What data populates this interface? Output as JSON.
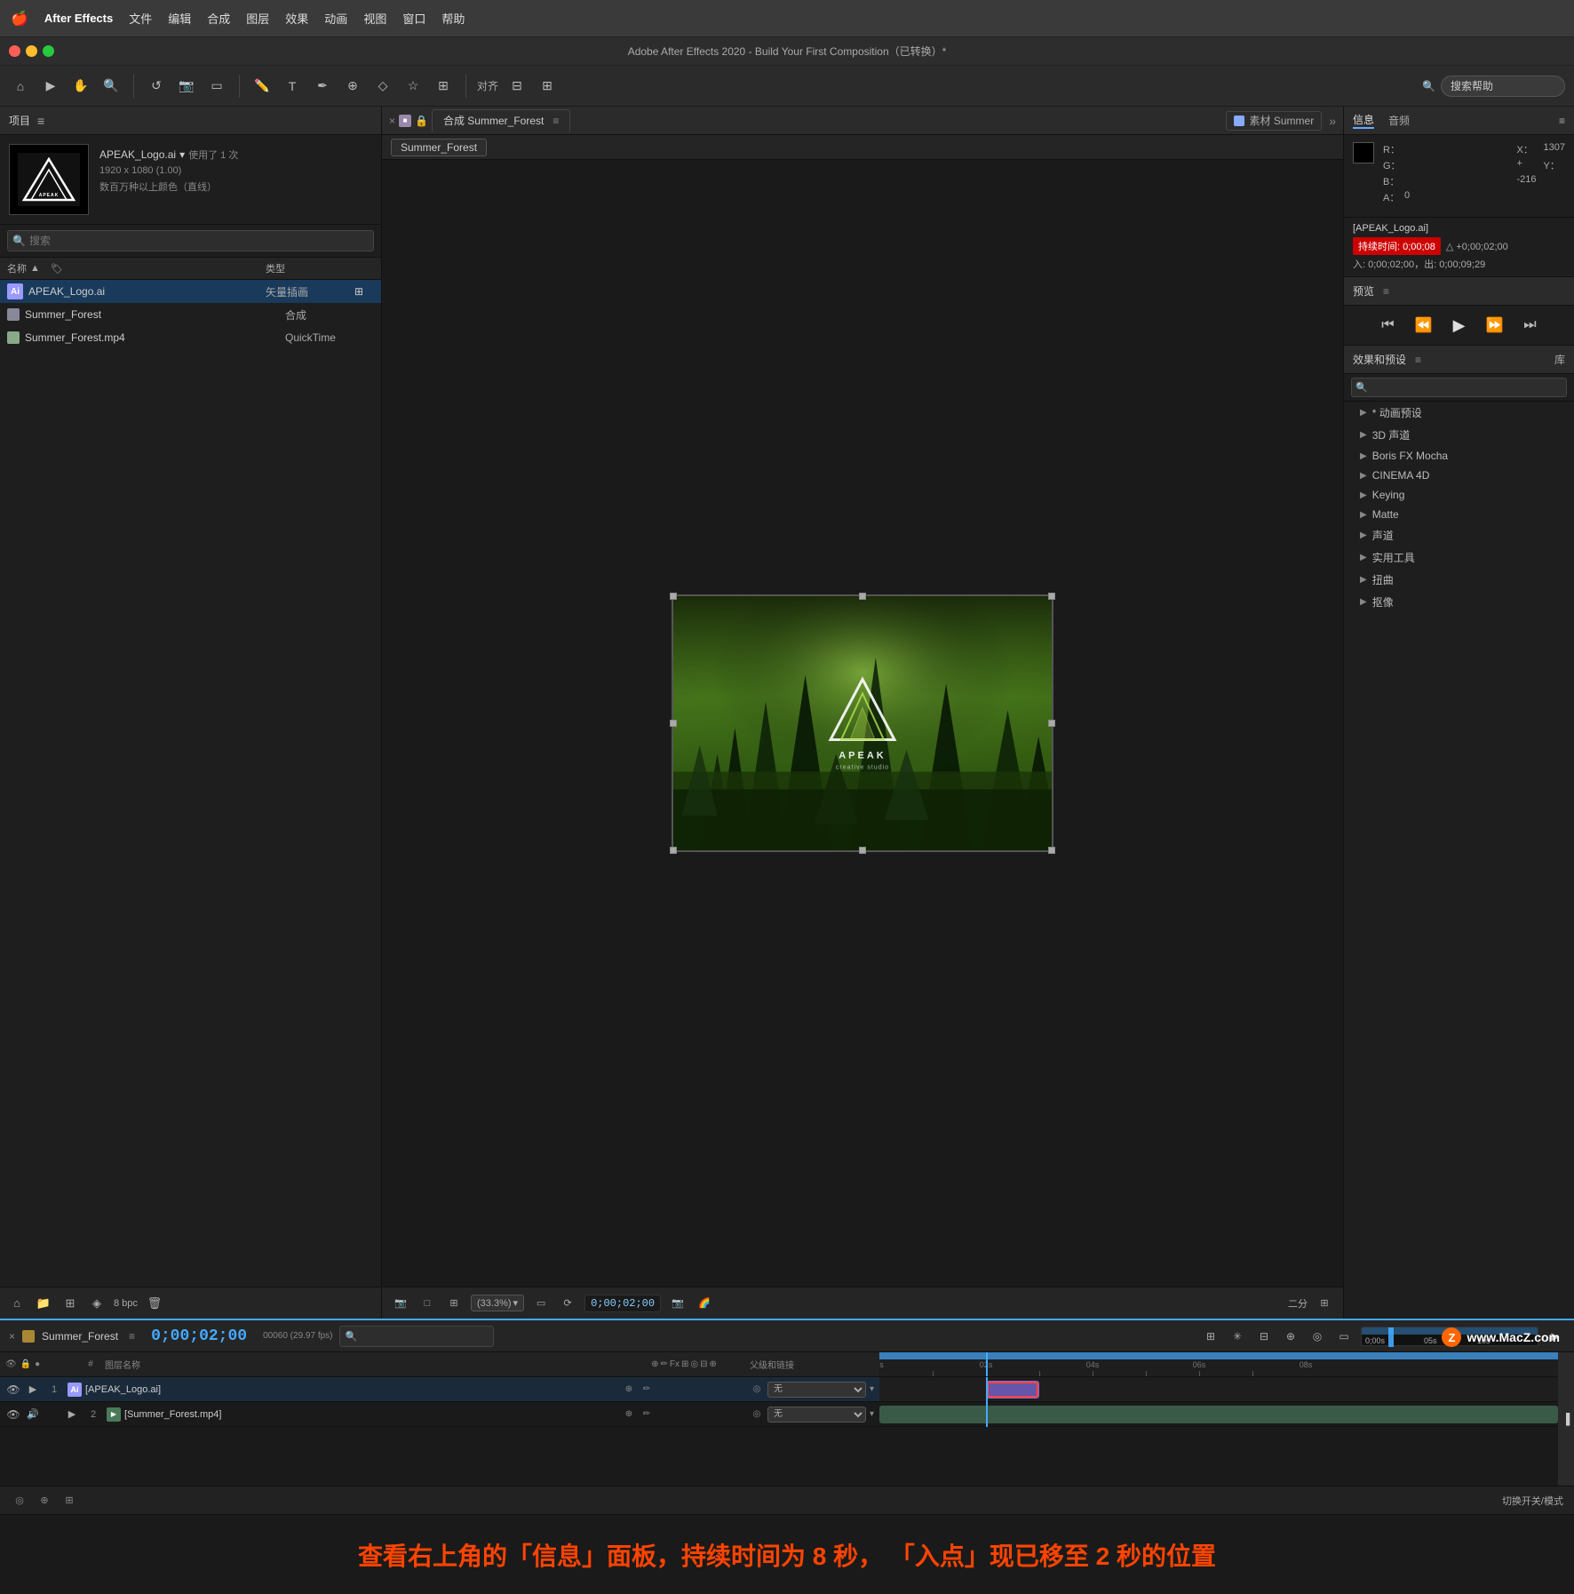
{
  "app": {
    "name": "After Effects",
    "title": "Adobe After Effects 2020 - Build Your First Composition（已转换）*"
  },
  "menubar": {
    "apple": "🍎",
    "items": [
      "After Effects",
      "文件",
      "编辑",
      "合成",
      "图层",
      "效果",
      "动画",
      "视图",
      "窗口",
      "帮助"
    ]
  },
  "toolbar": {
    "search_placeholder": "搜索帮助",
    "align_label": "对齐"
  },
  "left_panel": {
    "title": "项目",
    "menu_icon": "≡",
    "asset": {
      "name": "APEAK_Logo.ai",
      "dropdown": "▾",
      "usage": "使用了 1 次",
      "resolution": "1920 x 1080 (1.00)",
      "color": "数百万种以上颜色（直线）"
    },
    "search_placeholder": "搜索",
    "columns": {
      "name": "名称",
      "type": "类型"
    },
    "items": [
      {
        "name": "APEAK_Logo.ai",
        "type": "矢量插画",
        "icon_type": "ai",
        "selected": true
      },
      {
        "name": "Summer_Forest",
        "type": "合成",
        "icon_type": "comp"
      },
      {
        "name": "Summer_Forest.mp4",
        "type": "QuickTime",
        "icon_type": "video"
      }
    ],
    "bottom_bpc": "8 bpc"
  },
  "comp_panel": {
    "tabs": [
      {
        "label": "合成 Summer_Forest",
        "active": true,
        "close": "×"
      }
    ],
    "source_tab": "素材 Summer",
    "comp_name": "Summer_Forest",
    "viewer_bottom": {
      "zoom": "(33.3%)",
      "timecode": "0;00;02;00",
      "quality": "二分"
    }
  },
  "right_panel": {
    "tabs": [
      "信息",
      "音频"
    ],
    "info": {
      "r_label": "R：",
      "g_label": "G：",
      "b_label": "B：",
      "a_label": "A：",
      "a_value": "0",
      "x_label": "X：",
      "x_value": "1307",
      "y_label": "Y：",
      "y_value": "-216",
      "plus_label": "+",
      "asset_name": "[APEAK_Logo.ai]",
      "duration_label": "持续时间:",
      "duration_value": "0;00;08",
      "duration_full": "0;00;08",
      "extra1": "△ +0;00;02;00",
      "line2": "入: 0;00;02;00，出: 0;00;09;29"
    },
    "preview": {
      "title": "预览",
      "menu_icon": "≡"
    },
    "effects": {
      "title": "效果和预设",
      "menu_icon": "≡",
      "library": "库",
      "items": [
        "* 动画预设",
        "3D 声道",
        "Boris FX Mocha",
        "CINEMA 4D",
        "Keying",
        "Matte",
        "声道",
        "实用工具",
        "扭曲",
        "抠像"
      ]
    }
  },
  "timeline": {
    "comp_name": "Summer_Forest",
    "menu_icon": "≡",
    "timecode": "0;00;02;00",
    "fps": "00060 (29.97 fps)",
    "columns": {
      "layer_name": "图层名称",
      "parent": "父级和链接"
    },
    "layers": [
      {
        "num": "1",
        "name": "[APEAK_Logo.ai]",
        "color": "#9999ff",
        "icon_type": "ai",
        "parent": "无"
      },
      {
        "num": "2",
        "name": "[Summer_Forest.mp4]",
        "color": "#88bbaa",
        "icon_type": "video",
        "parent": "无"
      }
    ],
    "bottom_label": "切换开关/模式"
  },
  "annotation": {
    "text": "查看右上角的「信息」面板，持续时间为 8 秒，  「入点」现已移至 2 秒的位置"
  },
  "watermark": {
    "z_icon": "Z",
    "text": "www.MacZ.com"
  }
}
